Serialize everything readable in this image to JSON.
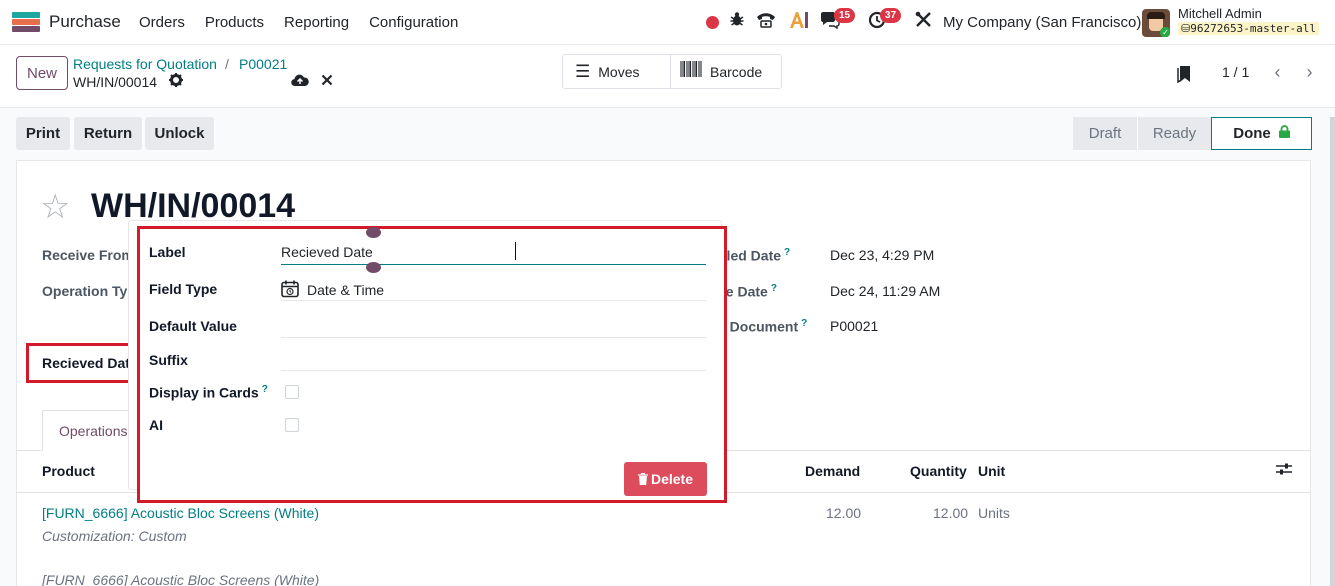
{
  "navbar": {
    "app_name": "Purchase",
    "menu": [
      "Orders",
      "Products",
      "Reporting",
      "Configuration"
    ],
    "messages_count": "15",
    "activities_count": "37",
    "company": "My Company (San Francisco)",
    "user_name": "Mitchell Admin",
    "db_name": "96272653-master-all"
  },
  "control": {
    "new_label": "New",
    "breadcrumb_parent": "Requests for Quotation",
    "breadcrumb_sep": "/",
    "breadcrumb_po": "P00021",
    "record_name": "WH/IN/00014",
    "moves_label": "Moves",
    "barcode_label": "Barcode",
    "pager": "1 / 1"
  },
  "actions": {
    "print": "Print",
    "return": "Return",
    "unlock": "Unlock"
  },
  "status": {
    "draft": "Draft",
    "ready": "Ready",
    "done": "Done"
  },
  "form": {
    "title": "WH/IN/00014",
    "receive_from_label": "Receive From",
    "operation_type_label": "Operation Typ",
    "scheduled_date_label": "uled Date",
    "scheduled_date_value": "Dec 23, 4:29 PM",
    "effective_date_label": "ve Date",
    "effective_date_value": "Dec 24, 11:29 AM",
    "source_doc_label": "e Document",
    "source_doc_value": "P00021",
    "recieved_date_label": "Recieved Date",
    "tab_operations": "Operations"
  },
  "table": {
    "headers": {
      "product": "Product",
      "demand": "Demand",
      "quantity": "Quantity",
      "unit": "Unit"
    },
    "rows": [
      {
        "product": "[FURN_6666] Acoustic Bloc Screens (White)",
        "note": "Customization: Custom",
        "demand": "12.00",
        "quantity": "12.00",
        "unit": "Units"
      }
    ],
    "next_row_product": "[FURN_6666] Acoustic Bloc Screens (White)"
  },
  "popover": {
    "label_label": "Label",
    "label_value": "Recieved Date",
    "field_type_label": "Field Type",
    "field_type_value": "Date & Time",
    "default_value_label": "Default Value",
    "suffix_label": "Suffix",
    "display_in_cards_label": "Display in Cards",
    "ai_label": "AI",
    "delete_label": "Delete"
  },
  "colors": {
    "brand": "#714b67",
    "link": "#017e84",
    "danger": "#dc3545",
    "highlight": "#d11a2a"
  }
}
